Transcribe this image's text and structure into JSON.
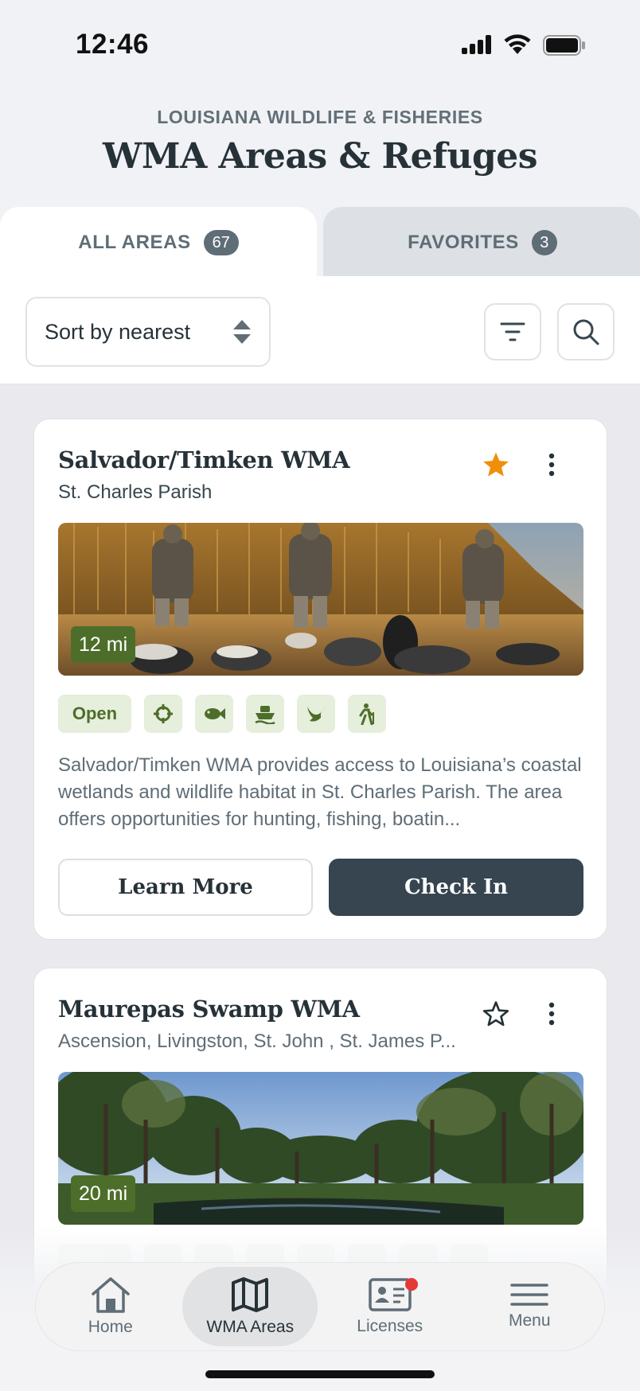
{
  "status_bar": {
    "time": "12:46"
  },
  "header": {
    "org": "LOUISIANA WILDLIFE & FISHERIES",
    "title": "WMA Areas & Refuges"
  },
  "tabs": [
    {
      "label": "ALL AREAS",
      "count": "67",
      "active": true
    },
    {
      "label": "FAVORITES",
      "count": "3",
      "active": false
    }
  ],
  "toolbar": {
    "sort_label": "Sort by nearest",
    "icons": [
      "filter-icon",
      "search-icon"
    ]
  },
  "cards": [
    {
      "name": "Salvador/Timken WMA",
      "parish": "St. Charles Parish",
      "favorite": true,
      "distance": "12 mi",
      "status": "Open",
      "activity_icons": [
        "target-icon",
        "fish-icon",
        "boat-icon",
        "bird-icon",
        "hiking-icon"
      ],
      "description": "Salvador/Timken WMA provides access to Louisiana’s coastal wetlands and wildlife habitat in St. Charles Parish. The area offers opportunities for hunting, fishing, boatin...",
      "learn_more": "Learn More",
      "check_in": "Check In"
    },
    {
      "name": "Maurepas Swamp WMA",
      "parish": "Ascension, Livingston, St. John , St. James P...",
      "favorite": false,
      "distance": "20 mi"
    }
  ],
  "nav": [
    {
      "label": "Home",
      "icon": "home-icon"
    },
    {
      "label": "WMA Areas",
      "icon": "map-icon",
      "active": true
    },
    {
      "label": "Licenses",
      "icon": "license-icon",
      "notification": true
    },
    {
      "label": "Menu",
      "icon": "menu-icon"
    }
  ],
  "colors": {
    "accent_green": "#4d6e2a",
    "chip_bg": "#e6eedc",
    "dark": "#36454f",
    "star": "#f0900a"
  }
}
